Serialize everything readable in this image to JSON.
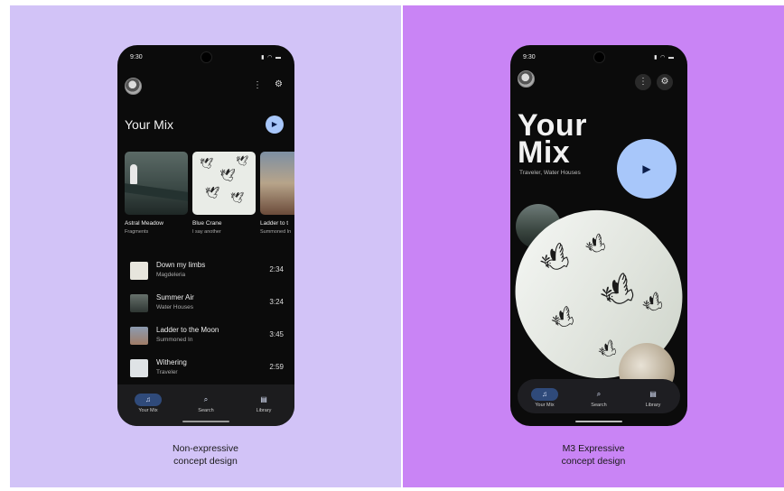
{
  "left": {
    "caption_line1": "Non-expressive",
    "caption_line2": "concept design",
    "status_time": "9:30",
    "title": "Your Mix",
    "cards": [
      {
        "title": "Astral Meadow",
        "subtitle": "Fragments"
      },
      {
        "title": "Blue Crane",
        "subtitle": "I say another"
      },
      {
        "title": "Ladder to t",
        "subtitle": "Summoned In"
      }
    ],
    "tracks": [
      {
        "title": "Down my limbs",
        "artist": "Magdeleria",
        "duration": "2:34"
      },
      {
        "title": "Summer Air",
        "artist": "Water Houses",
        "duration": "3:24"
      },
      {
        "title": "Ladder to the Moon",
        "artist": "Summoned In",
        "duration": "3:45"
      },
      {
        "title": "Withering",
        "artist": "Traveler",
        "duration": "2:59"
      }
    ],
    "nav": [
      {
        "label": "Your Mix",
        "icon": "your-mix-icon"
      },
      {
        "label": "Search",
        "icon": "search-icon"
      },
      {
        "label": "Library",
        "icon": "library-icon"
      }
    ]
  },
  "right": {
    "caption_line1": "M3 Expressive",
    "caption_line2": "concept design",
    "status_time": "9:30",
    "title_line1": "Your",
    "title_line2": "Mix",
    "subtitle": "Traveler, Water Houses",
    "nav": [
      {
        "label": "Your Mix",
        "icon": "your-mix-icon"
      },
      {
        "label": "Search",
        "icon": "search-icon"
      },
      {
        "label": "Library",
        "icon": "library-icon"
      }
    ]
  },
  "colors": {
    "left_bg": "#d2c3f7",
    "right_bg": "#c984f5",
    "phone_bg": "#0b0b0b",
    "accent": "#a8c7fa",
    "nav_active": "#2f4a7a"
  }
}
